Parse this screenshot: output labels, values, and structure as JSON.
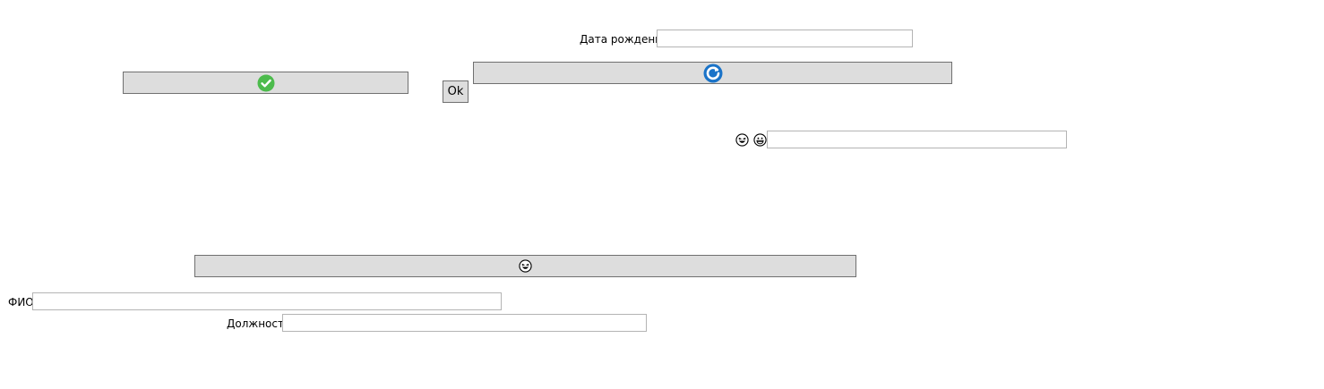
{
  "form": {
    "birth_date_label": "Дата рождения",
    "birth_date_value": "",
    "fio_label": "ФИО",
    "fio_value": "",
    "position_label": "Должность",
    "position_value": "",
    "emoji_field_value": ""
  },
  "buttons": {
    "ok_label": "Ok",
    "confirm_icon": "check-circle-icon",
    "refresh_icon": "refresh-icon",
    "wide_icon": "laughing-emoji-icon"
  },
  "icons": {
    "emoji_1": "laughing-emoji-icon",
    "emoji_2": "grinning-emoji-icon"
  },
  "colors": {
    "button_bg": "#dddddd",
    "button_border": "#707070",
    "field_border": "#b4b4b4",
    "check_green": "#4cbb4c",
    "refresh_blue": "#1a73c8"
  }
}
